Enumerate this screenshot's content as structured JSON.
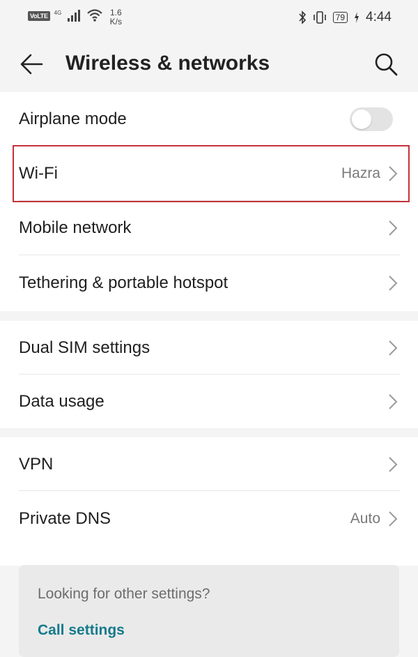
{
  "status_bar": {
    "volte": "VoLTE",
    "network_gen": "4G",
    "speed_value": "1.6",
    "speed_unit": "K/s",
    "battery": "79",
    "time": "4:44"
  },
  "header": {
    "title": "Wireless & networks"
  },
  "section1": {
    "airplane_label": "Airplane mode",
    "airplane_on": false,
    "wifi_label": "Wi-Fi",
    "wifi_value": "Hazra",
    "mobile_label": "Mobile network",
    "tethering_label": "Tethering & portable hotspot"
  },
  "section2": {
    "dual_sim_label": "Dual SIM settings",
    "data_usage_label": "Data usage"
  },
  "section3": {
    "vpn_label": "VPN",
    "private_dns_label": "Private DNS",
    "private_dns_value": "Auto"
  },
  "suggestion": {
    "title": "Looking for other settings?",
    "link": "Call settings"
  },
  "colors": {
    "accent_link": "#157a8c",
    "highlight_border": "#c5323a",
    "toggle_off": "#e3e3e3"
  }
}
